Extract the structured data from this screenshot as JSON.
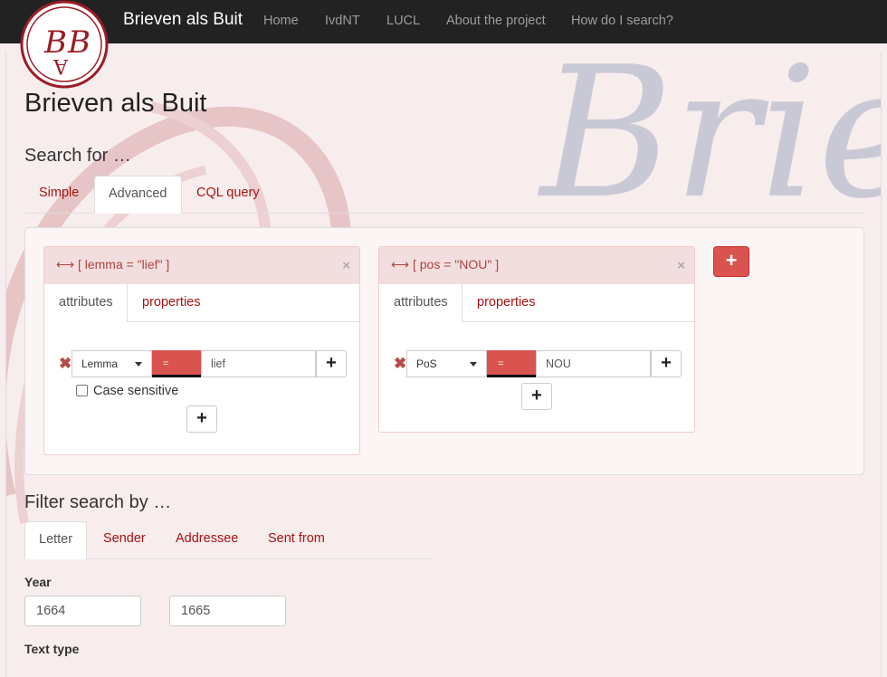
{
  "nav": {
    "brand": "Brieven als Buit",
    "links": [
      "Home",
      "IvdNT",
      "LUCL",
      "About the project",
      "How do I search?"
    ]
  },
  "logo": {
    "alt": "Brieven als Buit logo",
    "monogram": "BAB"
  },
  "background_text": "Brie",
  "page_title": "Brieven als Buit",
  "search": {
    "heading": "Search for …",
    "tabs": [
      "Simple",
      "Advanced",
      "CQL query"
    ],
    "active_tab": "Advanced",
    "tokens": [
      {
        "header": "[ lemma = \"lief\" ]",
        "tabs": [
          "attributes",
          "properties"
        ],
        "attribute": "Lemma",
        "operator": "=",
        "value": "lief",
        "case_sensitive_label": "Case sensitive",
        "case_sensitive": false
      },
      {
        "header": "[ pos = \"NOU\" ]",
        "tabs": [
          "attributes",
          "properties"
        ],
        "attribute": "PoS",
        "operator": "=",
        "value": "NOU"
      }
    ]
  },
  "filter": {
    "heading": "Filter search by …",
    "tabs": [
      "Letter",
      "Sender",
      "Addressee",
      "Sent from"
    ],
    "active_tab": "Letter",
    "year_label": "Year",
    "year_from": "1664",
    "year_to": "1665",
    "text_type_label": "Text type"
  },
  "colors": {
    "navbar": "#222222",
    "accent_red": "#d9534f",
    "link_red": "#aa1111",
    "token_header_bg": "#f2dede"
  }
}
